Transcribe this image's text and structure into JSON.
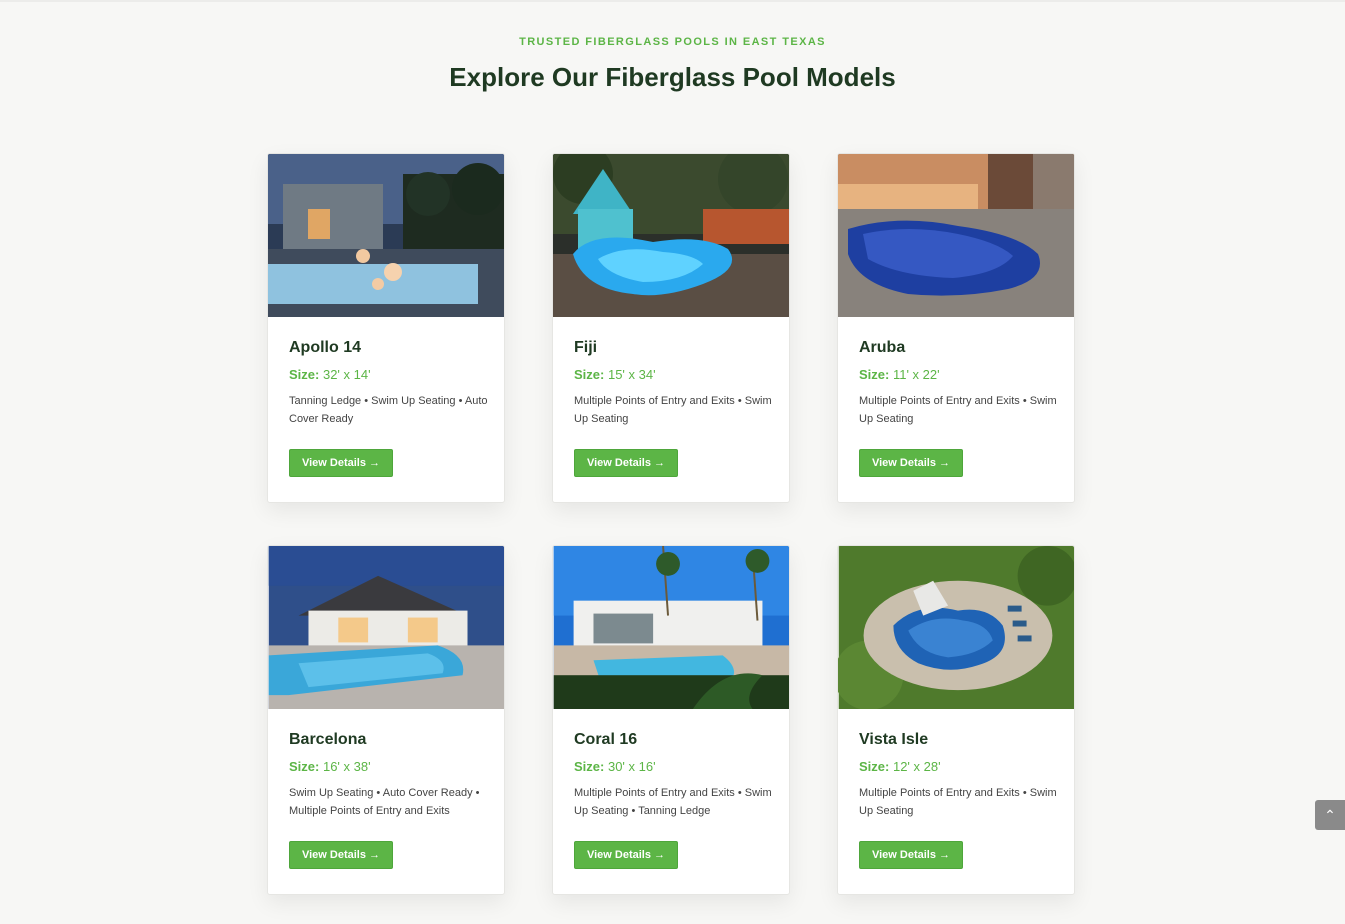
{
  "section": {
    "eyebrow": "TRUSTED FIBERGLASS POOLS IN EAST TEXAS",
    "heading": "Explore Our Fiberglass Pool Models"
  },
  "cards": [
    {
      "title": "Apollo 14",
      "size_label": "Size:",
      "size": "32' x 14'",
      "features": "Tanning Ledge • Swim Up Seating • Auto Cover Ready",
      "button": "View Details →"
    },
    {
      "title": "Fiji",
      "size_label": "Size:",
      "size": "15' x 34'",
      "features": "Multiple Points of Entry and Exits • Swim Up Seating",
      "button": "View Details →"
    },
    {
      "title": "Aruba",
      "size_label": "Size:",
      "size": "11' x 22'",
      "features": "Multiple Points of Entry and Exits • Swim Up Seating",
      "button": "View Details →"
    },
    {
      "title": "Barcelona",
      "size_label": "Size:",
      "size": "16' x 38'",
      "features": "Swim Up Seating • Auto Cover Ready • Multiple Points of Entry and Exits",
      "button": "View Details →"
    },
    {
      "title": "Coral 16",
      "size_label": "Size:",
      "size": "30' x 16'",
      "features": "Multiple Points of Entry and Exits • Swim Up Seating • Tanning Ledge",
      "button": "View Details →"
    },
    {
      "title": "Vista Isle",
      "size_label": "Size:",
      "size": "12' x 28'",
      "features": "Multiple Points of Entry and Exits • Swim Up Seating",
      "button": "View Details →"
    }
  ],
  "colors": {
    "accent": "#5cb546",
    "heading": "#1f3a22",
    "background": "#f7f7f5"
  },
  "scroll_top_icon": "chevron-up-icon"
}
